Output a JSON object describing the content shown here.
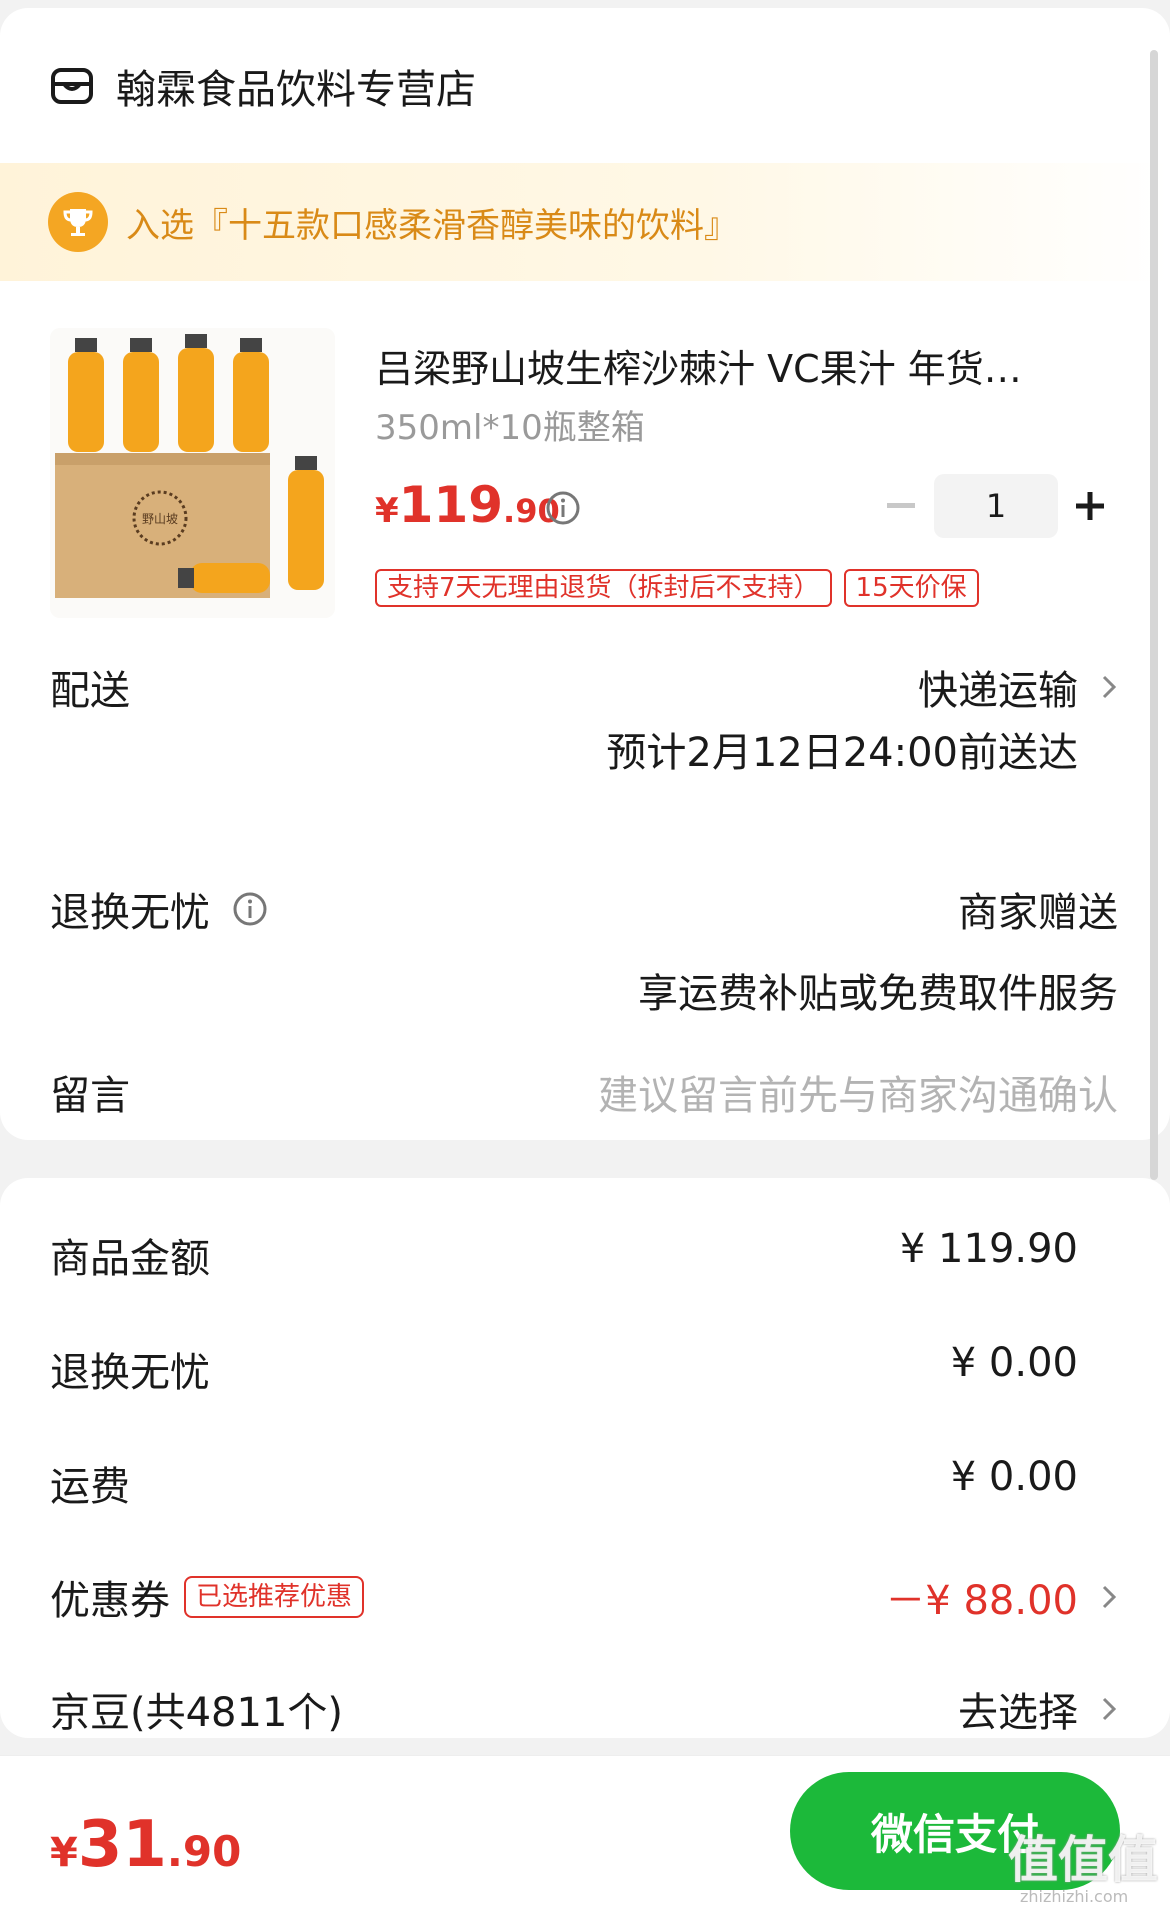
{
  "store": {
    "name": "翰霖食品饮料专营店"
  },
  "honor": {
    "text": "入选『十五款口感柔滑香醇美味的饮料』"
  },
  "product": {
    "title": "吕梁野山坡生榨沙棘汁 VC果汁 年货…",
    "spec": "350ml*10瓶整箱",
    "price_symbol": "¥",
    "price_int": "119",
    "price_dec": ".90",
    "quantity": "1",
    "tags": [
      "支持7天无理由退货（拆封后不支持）",
      "15天价保"
    ],
    "image_box_label": "野山坡"
  },
  "delivery": {
    "label": "配送",
    "method": "快递运输",
    "eta": "预计2月12日24:00前送达"
  },
  "returns": {
    "label": "退换无忧",
    "provider": "商家赠送",
    "desc": "享运费补贴或免费取件服务"
  },
  "message": {
    "label": "留言",
    "placeholder": "建议留言前先与商家沟通确认"
  },
  "fees": {
    "goods_label": "商品金额",
    "goods_value": "¥ 119.90",
    "returns_label": "退换无忧",
    "returns_value": "¥ 0.00",
    "shipping_label": "运费",
    "shipping_value": "¥ 0.00",
    "coupon_label": "优惠券",
    "coupon_badge": "已选推荐优惠",
    "coupon_value": "－¥ 88.00",
    "jd_label": "京豆(共4811个)",
    "jd_value": "去选择"
  },
  "footer": {
    "total_symbol": "¥",
    "total_int": "31",
    "total_dec": ".90",
    "pay_label": "微信支付"
  },
  "watermark": {
    "text": "值值值",
    "sub": "zhizhizhi.com"
  },
  "colors": {
    "price_red": "#e0322a",
    "pay_green": "#1cb93a",
    "honor_orange": "#d98a17"
  }
}
